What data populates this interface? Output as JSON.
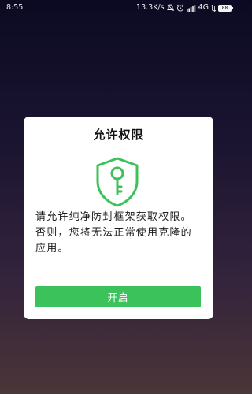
{
  "status_bar": {
    "time": "8:55",
    "net_speed": "13.3K/s",
    "network_type": "4G",
    "battery_level": "88",
    "icons": [
      "mute-icon",
      "alarm-icon",
      "signal-icon",
      "battery-icon"
    ]
  },
  "dialog": {
    "title": "允许权限",
    "icon": "key-shield-icon",
    "message_line_1": "请允许纯净防封框架获取权限。",
    "message_line_2": "否则，您将无法正常使用克隆的应用。",
    "button_label": "开启"
  },
  "colors": {
    "accent": "#3cc25a",
    "dialog_bg": "#ffffff",
    "bg_top": "#0c0a22",
    "bg_bottom": "#4a3537"
  }
}
